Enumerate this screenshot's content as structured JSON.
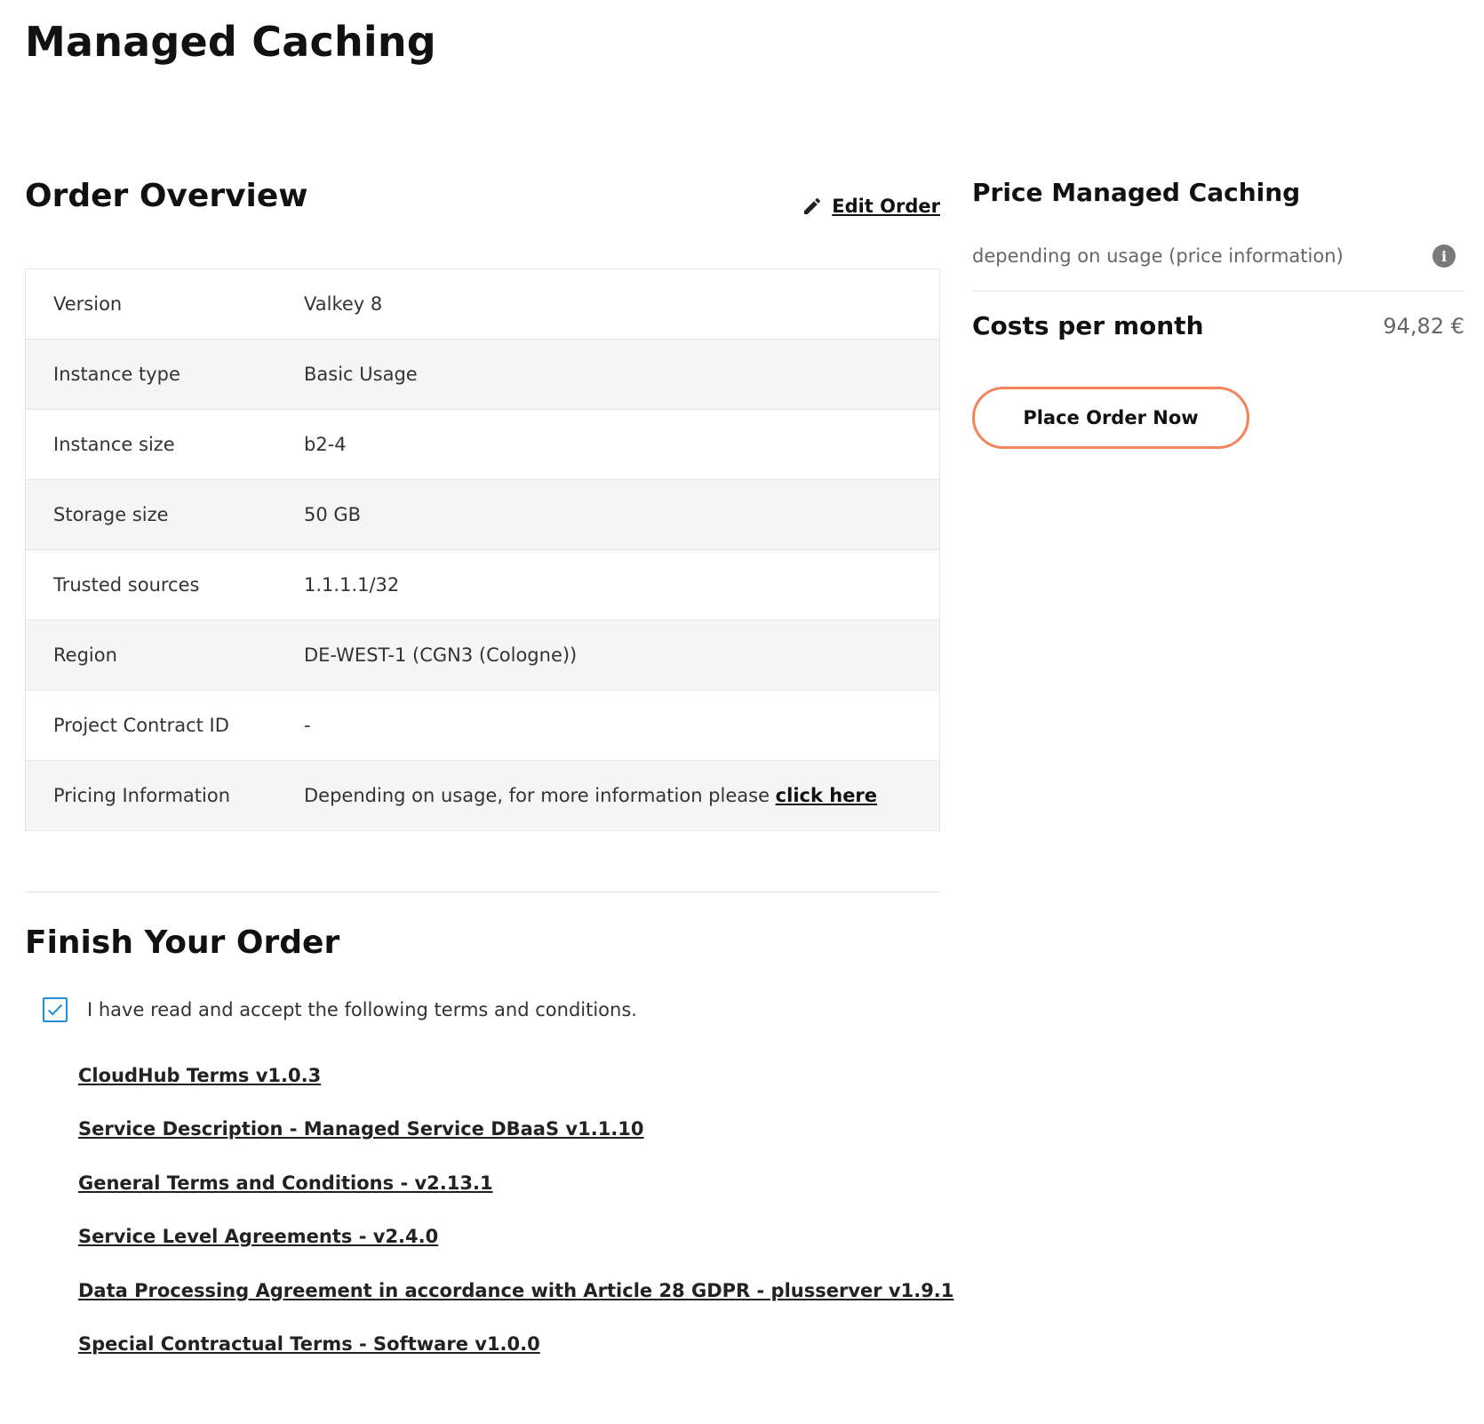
{
  "page": {
    "title": "Managed Caching"
  },
  "overview": {
    "title": "Order Overview",
    "edit_label": "Edit Order",
    "rows": [
      {
        "label": "Version",
        "value": "Valkey 8"
      },
      {
        "label": "Instance type",
        "value": "Basic Usage"
      },
      {
        "label": "Instance size",
        "value": "b2-4"
      },
      {
        "label": "Storage size",
        "value": "50 GB"
      },
      {
        "label": "Trusted sources",
        "value": "1.1.1.1/32"
      },
      {
        "label": "Region",
        "value": "DE-WEST-1 (CGN3 (Cologne))"
      },
      {
        "label": "Project Contract ID",
        "value": "-"
      },
      {
        "label": "Pricing Information",
        "value": "Depending on usage, for more information please ",
        "link": "click here"
      }
    ]
  },
  "finish": {
    "title": "Finish Your Order",
    "accept_label": "I have read and accept the following terms and conditions.",
    "accept_checked": true,
    "terms": [
      "CloudHub Terms v1.0.3",
      "Service Description - Managed Service DBaaS v1.1.10",
      "General Terms and Conditions - v2.13.1",
      "Service Level Agreements - v2.4.0",
      "Data Processing Agreement in accordance with Article 28 GDPR - plusserver v1.9.1",
      "Special Contractual Terms - Software v1.0.0"
    ]
  },
  "price": {
    "title": "Price Managed Caching",
    "usage_text": "depending on usage (price information)",
    "info_icon": "info-icon",
    "costs_label": "Costs per month",
    "costs_value": "94,82 €",
    "order_button": "Place Order Now"
  },
  "colors": {
    "accent": "#f3845c",
    "checkbox": "#1e90d6"
  }
}
